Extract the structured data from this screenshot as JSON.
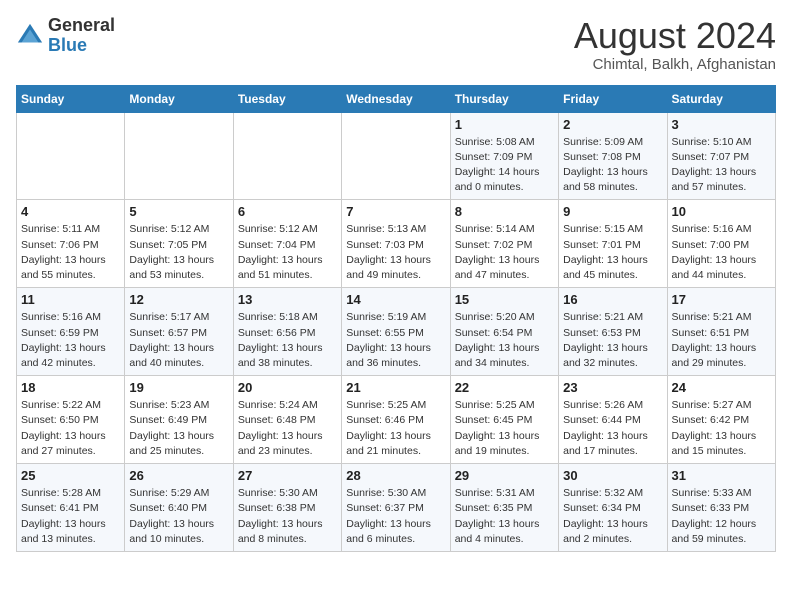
{
  "header": {
    "logo_line1": "General",
    "logo_line2": "Blue",
    "month_year": "August 2024",
    "location": "Chimtal, Balkh, Afghanistan"
  },
  "weekdays": [
    "Sunday",
    "Monday",
    "Tuesday",
    "Wednesday",
    "Thursday",
    "Friday",
    "Saturday"
  ],
  "weeks": [
    [
      {
        "day": "",
        "info": ""
      },
      {
        "day": "",
        "info": ""
      },
      {
        "day": "",
        "info": ""
      },
      {
        "day": "",
        "info": ""
      },
      {
        "day": "1",
        "info": "Sunrise: 5:08 AM\nSunset: 7:09 PM\nDaylight: 14 hours\nand 0 minutes."
      },
      {
        "day": "2",
        "info": "Sunrise: 5:09 AM\nSunset: 7:08 PM\nDaylight: 13 hours\nand 58 minutes."
      },
      {
        "day": "3",
        "info": "Sunrise: 5:10 AM\nSunset: 7:07 PM\nDaylight: 13 hours\nand 57 minutes."
      }
    ],
    [
      {
        "day": "4",
        "info": "Sunrise: 5:11 AM\nSunset: 7:06 PM\nDaylight: 13 hours\nand 55 minutes."
      },
      {
        "day": "5",
        "info": "Sunrise: 5:12 AM\nSunset: 7:05 PM\nDaylight: 13 hours\nand 53 minutes."
      },
      {
        "day": "6",
        "info": "Sunrise: 5:12 AM\nSunset: 7:04 PM\nDaylight: 13 hours\nand 51 minutes."
      },
      {
        "day": "7",
        "info": "Sunrise: 5:13 AM\nSunset: 7:03 PM\nDaylight: 13 hours\nand 49 minutes."
      },
      {
        "day": "8",
        "info": "Sunrise: 5:14 AM\nSunset: 7:02 PM\nDaylight: 13 hours\nand 47 minutes."
      },
      {
        "day": "9",
        "info": "Sunrise: 5:15 AM\nSunset: 7:01 PM\nDaylight: 13 hours\nand 45 minutes."
      },
      {
        "day": "10",
        "info": "Sunrise: 5:16 AM\nSunset: 7:00 PM\nDaylight: 13 hours\nand 44 minutes."
      }
    ],
    [
      {
        "day": "11",
        "info": "Sunrise: 5:16 AM\nSunset: 6:59 PM\nDaylight: 13 hours\nand 42 minutes."
      },
      {
        "day": "12",
        "info": "Sunrise: 5:17 AM\nSunset: 6:57 PM\nDaylight: 13 hours\nand 40 minutes."
      },
      {
        "day": "13",
        "info": "Sunrise: 5:18 AM\nSunset: 6:56 PM\nDaylight: 13 hours\nand 38 minutes."
      },
      {
        "day": "14",
        "info": "Sunrise: 5:19 AM\nSunset: 6:55 PM\nDaylight: 13 hours\nand 36 minutes."
      },
      {
        "day": "15",
        "info": "Sunrise: 5:20 AM\nSunset: 6:54 PM\nDaylight: 13 hours\nand 34 minutes."
      },
      {
        "day": "16",
        "info": "Sunrise: 5:21 AM\nSunset: 6:53 PM\nDaylight: 13 hours\nand 32 minutes."
      },
      {
        "day": "17",
        "info": "Sunrise: 5:21 AM\nSunset: 6:51 PM\nDaylight: 13 hours\nand 29 minutes."
      }
    ],
    [
      {
        "day": "18",
        "info": "Sunrise: 5:22 AM\nSunset: 6:50 PM\nDaylight: 13 hours\nand 27 minutes."
      },
      {
        "day": "19",
        "info": "Sunrise: 5:23 AM\nSunset: 6:49 PM\nDaylight: 13 hours\nand 25 minutes."
      },
      {
        "day": "20",
        "info": "Sunrise: 5:24 AM\nSunset: 6:48 PM\nDaylight: 13 hours\nand 23 minutes."
      },
      {
        "day": "21",
        "info": "Sunrise: 5:25 AM\nSunset: 6:46 PM\nDaylight: 13 hours\nand 21 minutes."
      },
      {
        "day": "22",
        "info": "Sunrise: 5:25 AM\nSunset: 6:45 PM\nDaylight: 13 hours\nand 19 minutes."
      },
      {
        "day": "23",
        "info": "Sunrise: 5:26 AM\nSunset: 6:44 PM\nDaylight: 13 hours\nand 17 minutes."
      },
      {
        "day": "24",
        "info": "Sunrise: 5:27 AM\nSunset: 6:42 PM\nDaylight: 13 hours\nand 15 minutes."
      }
    ],
    [
      {
        "day": "25",
        "info": "Sunrise: 5:28 AM\nSunset: 6:41 PM\nDaylight: 13 hours\nand 13 minutes."
      },
      {
        "day": "26",
        "info": "Sunrise: 5:29 AM\nSunset: 6:40 PM\nDaylight: 13 hours\nand 10 minutes."
      },
      {
        "day": "27",
        "info": "Sunrise: 5:30 AM\nSunset: 6:38 PM\nDaylight: 13 hours\nand 8 minutes."
      },
      {
        "day": "28",
        "info": "Sunrise: 5:30 AM\nSunset: 6:37 PM\nDaylight: 13 hours\nand 6 minutes."
      },
      {
        "day": "29",
        "info": "Sunrise: 5:31 AM\nSunset: 6:35 PM\nDaylight: 13 hours\nand 4 minutes."
      },
      {
        "day": "30",
        "info": "Sunrise: 5:32 AM\nSunset: 6:34 PM\nDaylight: 13 hours\nand 2 minutes."
      },
      {
        "day": "31",
        "info": "Sunrise: 5:33 AM\nSunset: 6:33 PM\nDaylight: 12 hours\nand 59 minutes."
      }
    ]
  ]
}
